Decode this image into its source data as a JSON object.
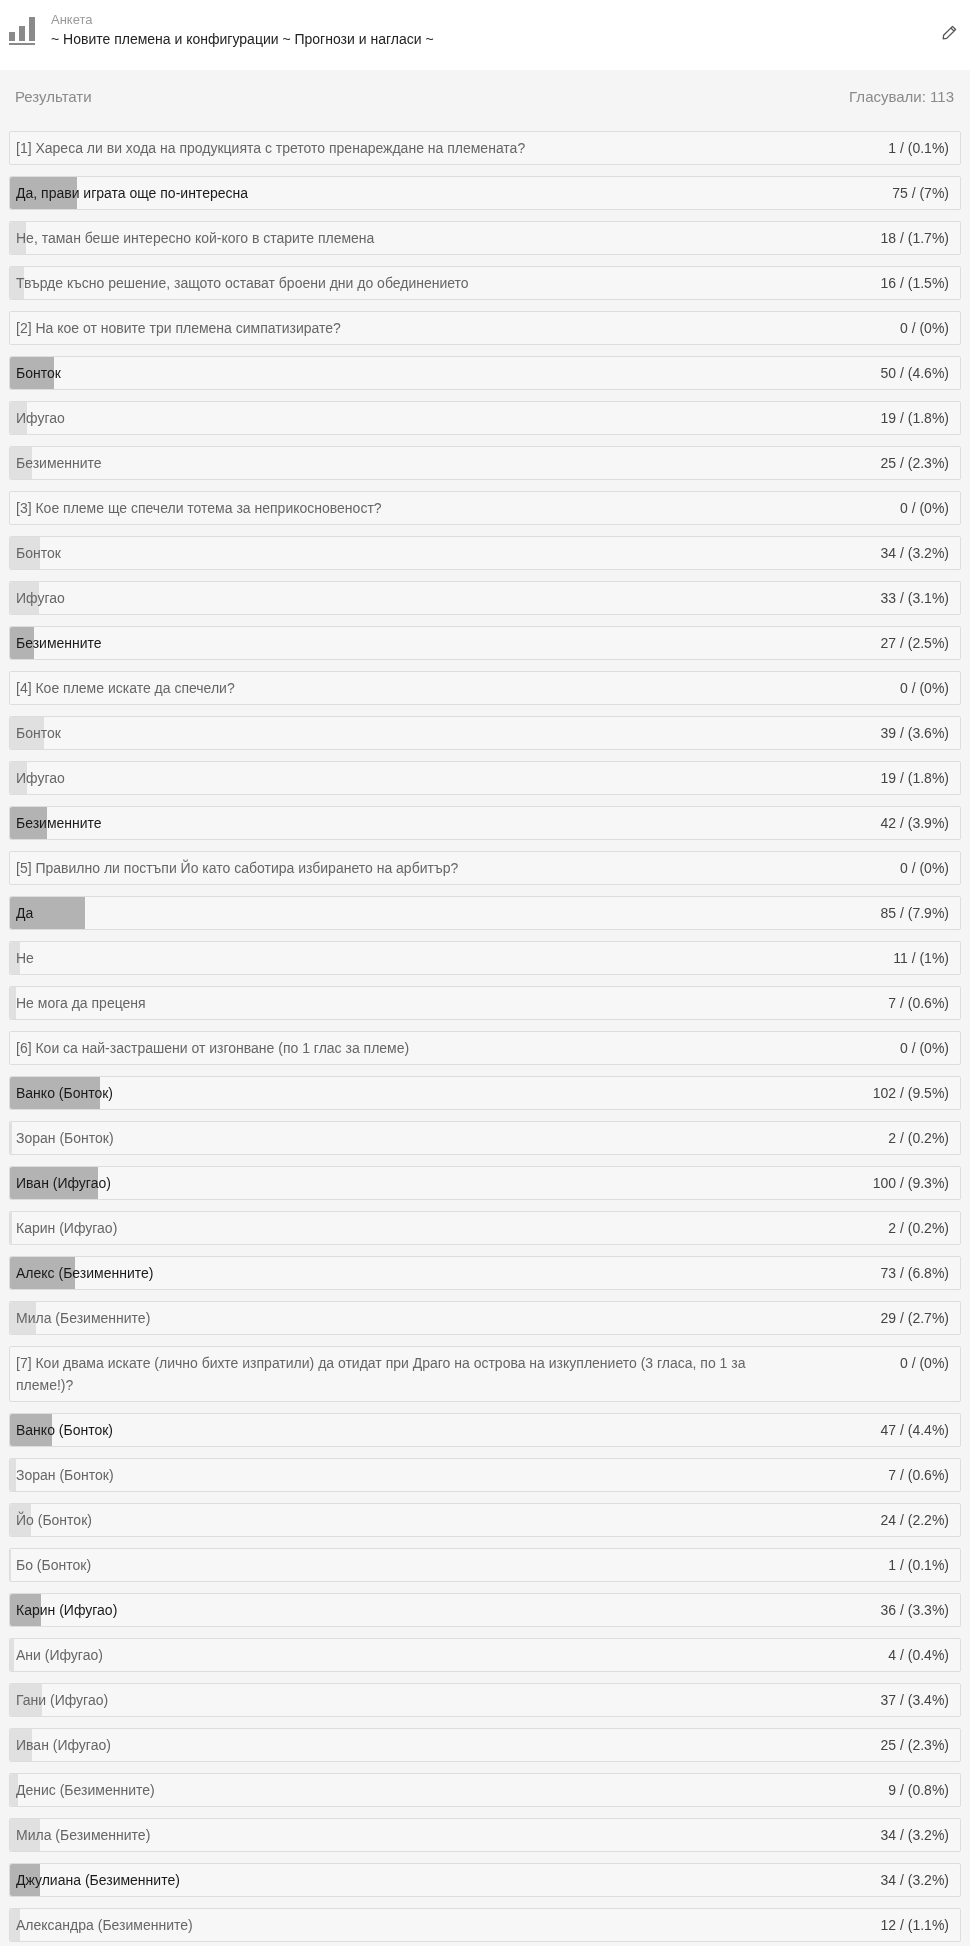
{
  "header": {
    "label": "Анкета",
    "title": "~ Новите племена и конфигурации ~ Прогнози и нагласи ~"
  },
  "results": {
    "heading": "Результати",
    "voters": "Гласували: 113"
  },
  "questions": [
    {
      "text": "[1] Хареса ли ви хода на продукцията с третото пренареждане на племената?",
      "votes": "1 / (0.1%)",
      "options": [
        {
          "label": "Да, прави играта още по-интересна",
          "votes": "75 / (7%)",
          "level": 0.07,
          "selected": true
        },
        {
          "label": "Не, таман беше интересно кой-кого в старите племена",
          "votes": "18 / (1.7%)",
          "level": 0.017,
          "selected": false
        },
        {
          "label": "Твърде късно решение, защото остават броени дни до обединението",
          "votes": "16 / (1.5%)",
          "level": 0.015,
          "selected": false
        }
      ]
    },
    {
      "text": "[2] На кое от новите три племена симпатизирате?",
      "votes": "0 / (0%)",
      "options": [
        {
          "label": "Бонток",
          "votes": "50 / (4.6%)",
          "level": 0.046,
          "selected": true
        },
        {
          "label": "Ифугао",
          "votes": "19 / (1.8%)",
          "level": 0.018,
          "selected": false
        },
        {
          "label": "Безименните",
          "votes": "25 / (2.3%)",
          "level": 0.023,
          "selected": false
        }
      ]
    },
    {
      "text": "[3] Кое племе ще спечели тотема за неприкосновеност?",
      "votes": "0 / (0%)",
      "options": [
        {
          "label": "Бонток",
          "votes": "34 / (3.2%)",
          "level": 0.032,
          "selected": false
        },
        {
          "label": "Ифугао",
          "votes": "33 / (3.1%)",
          "level": 0.031,
          "selected": false
        },
        {
          "label": "Безименните",
          "votes": "27 / (2.5%)",
          "level": 0.025,
          "selected": true
        }
      ]
    },
    {
      "text": "[4] Кое племе искате да спечели?",
      "votes": "0 / (0%)",
      "options": [
        {
          "label": "Бонток",
          "votes": "39 / (3.6%)",
          "level": 0.036,
          "selected": false
        },
        {
          "label": "Ифугао",
          "votes": "19 / (1.8%)",
          "level": 0.018,
          "selected": false
        },
        {
          "label": "Безименните",
          "votes": "42 / (3.9%)",
          "level": 0.039,
          "selected": true
        }
      ]
    },
    {
      "text": "[5] Правилно ли постъпи Йо като саботира избирането на арбитър?",
      "votes": "0 / (0%)",
      "options": [
        {
          "label": "Да",
          "votes": "85 / (7.9%)",
          "level": 0.079,
          "selected": true
        },
        {
          "label": "Не",
          "votes": "11 / (1%)",
          "level": 0.01,
          "selected": false
        },
        {
          "label": "Не мога да преценя",
          "votes": "7 / (0.6%)",
          "level": 0.006,
          "selected": false
        }
      ]
    },
    {
      "text": "[6] Кои са най-застрашени от изгонване (по 1 глас за племе)",
      "votes": "0 / (0%)",
      "options": [
        {
          "label": "Ванко (Бонток)",
          "votes": "102 / (9.5%)",
          "level": 0.095,
          "selected": true
        },
        {
          "label": "Зоран (Бонток)",
          "votes": "2 / (0.2%)",
          "level": 0.002,
          "selected": false
        },
        {
          "label": "Иван (Ифугао)",
          "votes": "100 / (9.3%)",
          "level": 0.093,
          "selected": true
        },
        {
          "label": "Карин (Ифугао)",
          "votes": "2 / (0.2%)",
          "level": 0.002,
          "selected": false
        },
        {
          "label": "Алекс (Безименните)",
          "votes": "73 / (6.8%)",
          "level": 0.068,
          "selected": true
        },
        {
          "label": "Мила (Безименните)",
          "votes": "29 / (2.7%)",
          "level": 0.027,
          "selected": false
        }
      ]
    },
    {
      "text": "[7] Кои двама искате (лично бихте изпратили) да отидат при Драго на острова на изкуплението (3 гласа, по 1 за племе!)?",
      "votes": "0 / (0%)",
      "options": [
        {
          "label": "Ванко (Бонток)",
          "votes": "47 / (4.4%)",
          "level": 0.044,
          "selected": true
        },
        {
          "label": "Зоран (Бонток)",
          "votes": "7 / (0.6%)",
          "level": 0.006,
          "selected": false
        },
        {
          "label": "Йо (Бонток)",
          "votes": "24 / (2.2%)",
          "level": 0.022,
          "selected": false
        },
        {
          "label": "Бо (Бонток)",
          "votes": "1 / (0.1%)",
          "level": 0.001,
          "selected": false
        },
        {
          "label": "Карин (Ифугао)",
          "votes": "36 / (3.3%)",
          "level": 0.033,
          "selected": true
        },
        {
          "label": "Ани (Ифугао)",
          "votes": "4 / (0.4%)",
          "level": 0.004,
          "selected": false
        },
        {
          "label": "Гани (Ифугао)",
          "votes": "37 / (3.4%)",
          "level": 0.034,
          "selected": false
        },
        {
          "label": "Иван (Ифугао)",
          "votes": "25 / (2.3%)",
          "level": 0.023,
          "selected": false
        },
        {
          "label": "Денис (Безименните)",
          "votes": "9 / (0.8%)",
          "level": 0.008,
          "selected": false
        },
        {
          "label": "Мила (Безименните)",
          "votes": "34 / (3.2%)",
          "level": 0.032,
          "selected": false
        },
        {
          "label": "Джулиана (Безименните)",
          "votes": "34 / (3.2%)",
          "level": 0.032,
          "selected": true
        },
        {
          "label": "Александра (Безименните)",
          "votes": "12 / (1.1%)",
          "level": 0.011,
          "selected": false
        }
      ]
    }
  ]
}
